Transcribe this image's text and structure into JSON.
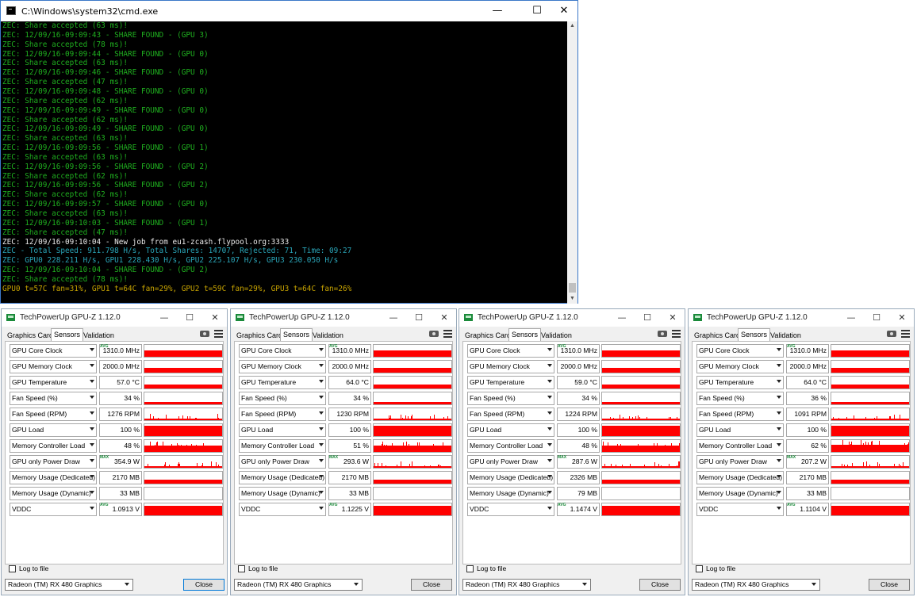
{
  "cmd": {
    "title": "C:\\Windows\\system32\\cmd.exe",
    "controls": {
      "minimize": "—",
      "maximize": "☐",
      "close": "✕"
    },
    "lines": [
      {
        "text": "ZEC: Share accepted (63 ms)!",
        "color": "#1fae1f"
      },
      {
        "text": "ZEC: 12/09/16-09:09:43 - SHARE FOUND - (GPU 3)",
        "color": "#1fae1f"
      },
      {
        "text": "ZEC: Share accepted (78 ms)!",
        "color": "#1fae1f"
      },
      {
        "text": "ZEC: 12/09/16-09:09:44 - SHARE FOUND - (GPU 0)",
        "color": "#1fae1f"
      },
      {
        "text": "ZEC: Share accepted (63 ms)!",
        "color": "#1fae1f"
      },
      {
        "text": "ZEC: 12/09/16-09:09:46 - SHARE FOUND - (GPU 0)",
        "color": "#1fae1f"
      },
      {
        "text": "ZEC: Share accepted (47 ms)!",
        "color": "#1fae1f"
      },
      {
        "text": "ZEC: 12/09/16-09:09:48 - SHARE FOUND - (GPU 0)",
        "color": "#1fae1f"
      },
      {
        "text": "ZEC: Share accepted (62 ms)!",
        "color": "#1fae1f"
      },
      {
        "text": "ZEC: 12/09/16-09:09:49 - SHARE FOUND - (GPU 0)",
        "color": "#1fae1f"
      },
      {
        "text": "ZEC: Share accepted (62 ms)!",
        "color": "#1fae1f"
      },
      {
        "text": "ZEC: 12/09/16-09:09:49 - SHARE FOUND - (GPU 0)",
        "color": "#1fae1f"
      },
      {
        "text": "ZEC: Share accepted (63 ms)!",
        "color": "#1fae1f"
      },
      {
        "text": "ZEC: 12/09/16-09:09:56 - SHARE FOUND - (GPU 1)",
        "color": "#1fae1f"
      },
      {
        "text": "ZEC: Share accepted (63 ms)!",
        "color": "#1fae1f"
      },
      {
        "text": "ZEC: 12/09/16-09:09:56 - SHARE FOUND - (GPU 2)",
        "color": "#1fae1f"
      },
      {
        "text": "ZEC: Share accepted (62 ms)!",
        "color": "#1fae1f"
      },
      {
        "text": "ZEC: 12/09/16-09:09:56 - SHARE FOUND - (GPU 2)",
        "color": "#1fae1f"
      },
      {
        "text": "ZEC: Share accepted (62 ms)!",
        "color": "#1fae1f"
      },
      {
        "text": "ZEC: 12/09/16-09:09:57 - SHARE FOUND - (GPU 0)",
        "color": "#1fae1f"
      },
      {
        "text": "ZEC: Share accepted (63 ms)!",
        "color": "#1fae1f"
      },
      {
        "text": "ZEC: 12/09/16-09:10:03 - SHARE FOUND - (GPU 1)",
        "color": "#1fae1f"
      },
      {
        "text": "ZEC: Share accepted (47 ms)!",
        "color": "#1fae1f"
      },
      {
        "text": "ZEC: 12/09/16-09:10:04 - New job from eu1-zcash.flypool.org:3333",
        "color": "#e8e8e8"
      },
      {
        "text": "ZEC - Total Speed: 911.798 H/s, Total Shares: 14707, Rejected: 71, Time: 09:27",
        "color": "#2aa5b8"
      },
      {
        "text": "ZEC: GPU0 228.211 H/s, GPU1 228.430 H/s, GPU2 225.107 H/s, GPU3 230.050 H/s",
        "color": "#2aa5b8"
      },
      {
        "text": "ZEC: 12/09/16-09:10:04 - SHARE FOUND - (GPU 2)",
        "color": "#1fae1f"
      },
      {
        "text": "ZEC: Share accepted (78 ms)!",
        "color": "#1fae1f"
      },
      {
        "text": "GPU0 t=57C fan=31%, GPU1 t=64C fan=29%, GPU2 t=59C fan=29%, GPU3 t=64C fan=26%",
        "color": "#c8a400"
      }
    ]
  },
  "gpuz_common": {
    "title": "TechPowerUp GPU-Z 1.12.0",
    "tabs": [
      "Graphics Card",
      "Sensors",
      "Validation"
    ],
    "active_tab": "Sensors",
    "log_label": "Log to file",
    "close_label": "Close",
    "sensor_labels": [
      "GPU Core Clock",
      "GPU Memory Clock",
      "GPU Temperature",
      "Fan Speed (%)",
      "Fan Speed (RPM)",
      "GPU Load",
      "Memory Controller Load",
      "GPU only Power Draw",
      "Memory Usage (Dedicated)",
      "Memory Usage (Dynamic)",
      "VDDC"
    ],
    "graph_color": "#ff0000"
  },
  "gpuz": [
    {
      "card": "Radeon (TM) RX 480 Graphics",
      "sensors": [
        {
          "value": "1310.0 MHz",
          "tag": "AVG",
          "level": 0.55
        },
        {
          "value": "2000.0 MHz",
          "tag": "",
          "level": 0.4
        },
        {
          "value": "57.0 °C",
          "tag": "",
          "level": 0.3
        },
        {
          "value": "34 %",
          "tag": "",
          "level": 0.2
        },
        {
          "value": "1276 RPM",
          "tag": "",
          "level": 0.15
        },
        {
          "value": "100 %",
          "tag": "",
          "level": 0.85
        },
        {
          "value": "48 %",
          "tag": "",
          "level": 0.5
        },
        {
          "value": "354.9 W",
          "tag": "MAX",
          "level": 0.15
        },
        {
          "value": "2170 MB",
          "tag": "",
          "level": 0.3
        },
        {
          "value": "33 MB",
          "tag": "",
          "level": 0.0
        },
        {
          "value": "1.0913 V",
          "tag": "AVG",
          "level": 0.8
        }
      ]
    },
    {
      "card": "Radeon (TM) RX 480 Graphics",
      "sensors": [
        {
          "value": "1310.0 MHz",
          "tag": "AVG",
          "level": 0.55
        },
        {
          "value": "2000.0 MHz",
          "tag": "",
          "level": 0.4
        },
        {
          "value": "64.0 °C",
          "tag": "",
          "level": 0.3
        },
        {
          "value": "34 %",
          "tag": "",
          "level": 0.2
        },
        {
          "value": "1230 RPM",
          "tag": "",
          "level": 0.12
        },
        {
          "value": "100 %",
          "tag": "",
          "level": 0.85
        },
        {
          "value": "51 %",
          "tag": "",
          "level": 0.5
        },
        {
          "value": "293.6 W",
          "tag": "MAX",
          "level": 0.15
        },
        {
          "value": "2170 MB",
          "tag": "",
          "level": 0.3
        },
        {
          "value": "33 MB",
          "tag": "",
          "level": 0.0
        },
        {
          "value": "1.1225 V",
          "tag": "AVG",
          "level": 0.8
        }
      ]
    },
    {
      "card": "Radeon (TM) RX 480 Graphics",
      "sensors": [
        {
          "value": "1310.0 MHz",
          "tag": "AVG",
          "level": 0.55
        },
        {
          "value": "2000.0 MHz",
          "tag": "",
          "level": 0.4
        },
        {
          "value": "59.0 °C",
          "tag": "",
          "level": 0.3
        },
        {
          "value": "34 %",
          "tag": "",
          "level": 0.2
        },
        {
          "value": "1224 RPM",
          "tag": "",
          "level": 0.12
        },
        {
          "value": "100 %",
          "tag": "",
          "level": 0.85
        },
        {
          "value": "48 %",
          "tag": "",
          "level": 0.5
        },
        {
          "value": "287.6 W",
          "tag": "MAX",
          "level": 0.15
        },
        {
          "value": "2326 MB",
          "tag": "",
          "level": 0.3
        },
        {
          "value": "79 MB",
          "tag": "",
          "level": 0.0
        },
        {
          "value": "1.1474 V",
          "tag": "AVG",
          "level": 0.8
        }
      ]
    },
    {
      "card": "Radeon (TM) RX 480 Graphics",
      "sensors": [
        {
          "value": "1310.0 MHz",
          "tag": "AVG",
          "level": 0.55
        },
        {
          "value": "2000.0 MHz",
          "tag": "",
          "level": 0.4
        },
        {
          "value": "64.0 °C",
          "tag": "",
          "level": 0.3
        },
        {
          "value": "36 %",
          "tag": "",
          "level": 0.2
        },
        {
          "value": "1091 RPM",
          "tag": "",
          "level": 0.12
        },
        {
          "value": "100 %",
          "tag": "",
          "level": 0.85
        },
        {
          "value": "62 %",
          "tag": "",
          "level": 0.6
        },
        {
          "value": "207.2 W",
          "tag": "MAX",
          "level": 0.15
        },
        {
          "value": "2170 MB",
          "tag": "",
          "level": 0.3
        },
        {
          "value": "33 MB",
          "tag": "",
          "level": 0.0
        },
        {
          "value": "1.1104 V",
          "tag": "AVG",
          "level": 0.8
        }
      ]
    }
  ]
}
